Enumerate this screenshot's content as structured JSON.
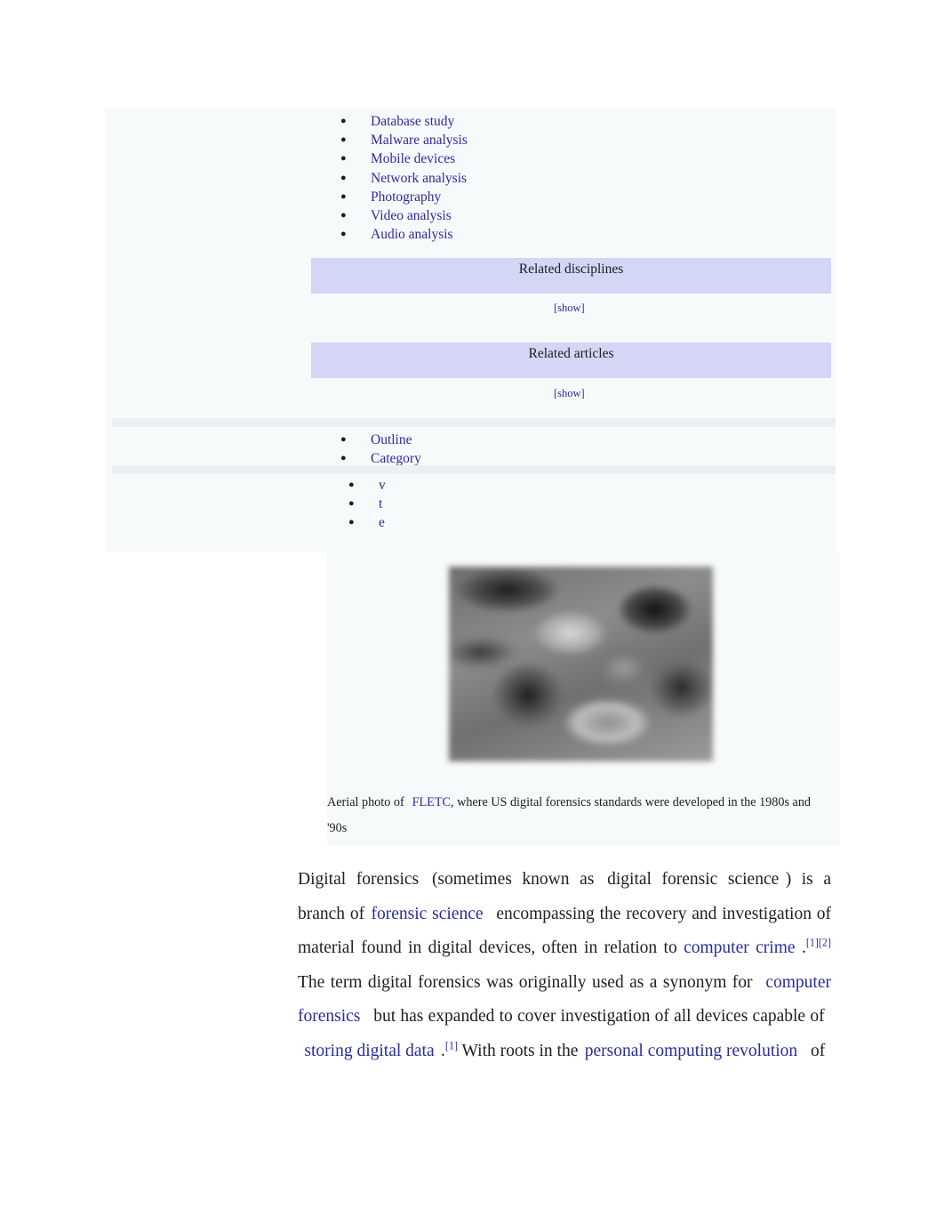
{
  "infobox": {
    "techniques": [
      {
        "label": "Database study"
      },
      {
        "label": "Malware analysis"
      },
      {
        "label": "Mobile devices"
      },
      {
        "label": "Network analysis"
      },
      {
        "label": "Photography"
      },
      {
        "label": "Video analysis"
      },
      {
        "label": "Audio analysis"
      }
    ],
    "collapsible_sections": [
      {
        "title": "Related disciplines",
        "toggle": "[show]"
      },
      {
        "title": "Related articles",
        "toggle": "[show]"
      }
    ],
    "nav_links": [
      {
        "label": "Outline"
      },
      {
        "label": "Category"
      }
    ],
    "vte_links": [
      {
        "label": "v"
      },
      {
        "label": "t"
      },
      {
        "label": "e"
      }
    ]
  },
  "figure": {
    "caption_pre": "Aerial photo of",
    "caption_link": "FLETC",
    "caption_post": ", where US digital forensics standards were developed in the 1980s and '90s"
  },
  "article": {
    "p1": {
      "t1": "Digital forensics",
      "t2": "(sometimes known as",
      "t3": "digital forensic science",
      "t4": ") is a branch of",
      "link1": "forensic science",
      "t5": "encompassing the recovery and investigation of material found in digital devices, often in relation to",
      "link2": "computer crime",
      "t6": ".",
      "cite1": "[1]",
      "cite2": "[2]",
      "t7": "The term digital forensics was originally used as a synonym for",
      "link3": "computer forensics",
      "t8": "but has expanded to cover investigation of all devices capable of",
      "link4": "storing digital data",
      "t9": ".",
      "cite3": "[1]",
      "t10": "With roots in the",
      "link5": "personal computing revolution",
      "t11": "of"
    }
  },
  "colors": {
    "link": "#2b2b9e",
    "panel_bg": "#f6fafb",
    "collapsible_bar": "#d3d6f5",
    "text": "#202122"
  }
}
